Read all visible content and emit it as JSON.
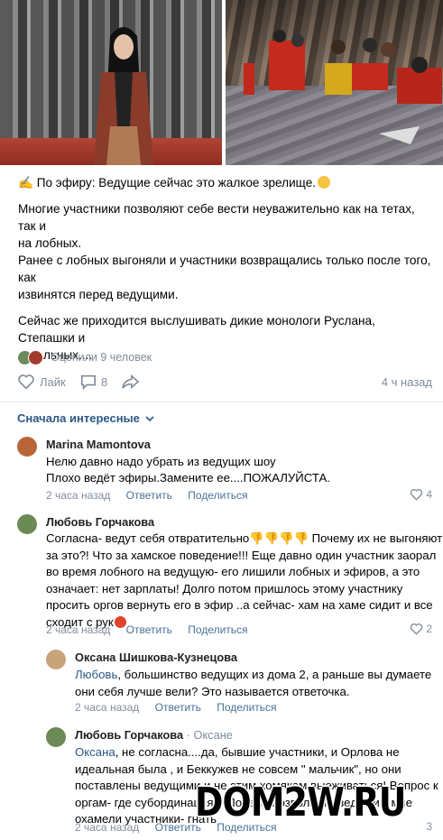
{
  "post": {
    "paragraph1": "✍️ По эфиру: Ведущие сейчас это жалкое зрелище.",
    "paragraph2_line1": "Многие участники позволяют себе вести неуважительно как на тетах, так и",
    "paragraph2_line2": "на лобных.",
    "paragraph2_line3": "Ранее с лобных выгоняли и участники возвращались только после того, как",
    "paragraph2_line4": "извинятся перед ведущими.",
    "paragraph3_line1": "Сейчас же приходится выслушивать дикие монологи Руслана, Степашки и",
    "paragraph3_line2": "остальных...."
  },
  "reactions": {
    "label": "Оценили 9 человек"
  },
  "actions": {
    "like_label": "Лайк",
    "comments_count": "8",
    "time": "4 ч назад"
  },
  "sort": {
    "label": "Сначала интересные"
  },
  "comments": [
    {
      "author": "Marina Mamontova",
      "lines": [
        "Нелю давно надо убрать из ведущих шоу",
        "Плохо ведёт эфиры.Замените ее....ПОЖАЛУЙСТА."
      ],
      "time": "2 часа назад",
      "reply": "Ответить",
      "share": "Поделиться",
      "likes": "4",
      "avatar_color": "#b9653a"
    },
    {
      "author": "Любовь Горчакова",
      "lines": [
        "Согласна- ведут себя отвратительно",
        "Почему их не выгоняют",
        "за это?! Что за хамское поведение!!! Еще давно один участник заорал",
        "во время лобного на ведущую- его лишили лобных и эфиров, а это",
        "означает: нет зарплаты! Долго потом пришлось этому участнику",
        "просить оргов вернуть его в эфир ..а сейчас- хам на хаме сидит и все",
        "сходит с рук"
      ],
      "time": "2 часа назад",
      "reply": "Ответить",
      "share": "Поделиться",
      "likes": "2",
      "avatar_color": "#6c8a55"
    },
    {
      "author": "Оксана Шишкова-Кузнецова",
      "mention": "Любовь",
      "lines": [
        ", большинство ведущих из дома 2, а раньше вы думаете",
        "они себя лучше вели? Это называется ответочка."
      ],
      "time": "2 часа назад",
      "reply": "Ответить",
      "share": "Поделиться",
      "avatar_color": "#c9a37a"
    },
    {
      "author": "Любовь Горчакова",
      "reply_to": "· Оксане",
      "mention": "Оксана",
      "lines": [
        ", не согласна....да, бывшие участники, и Орлова не",
        "идеальная была , и Беккужев не совсем \" мальчик\", но они",
        "поставлены ведущими и не этим хомякам выеживаться! Вопрос к",
        "оргам- где субординация?! Почему позволяете ведущим мне",
        "охамели участники- гнать"
      ],
      "time": "2 часа назад",
      "reply": "Ответить",
      "share": "Поделиться",
      "likes": "3",
      "avatar_color": "#6c8a55"
    }
  ],
  "watermark": "DOM2W.RU",
  "colors": {
    "link": "#2a5885",
    "secondary": "#818c99",
    "divider": "#e7e8ec"
  }
}
